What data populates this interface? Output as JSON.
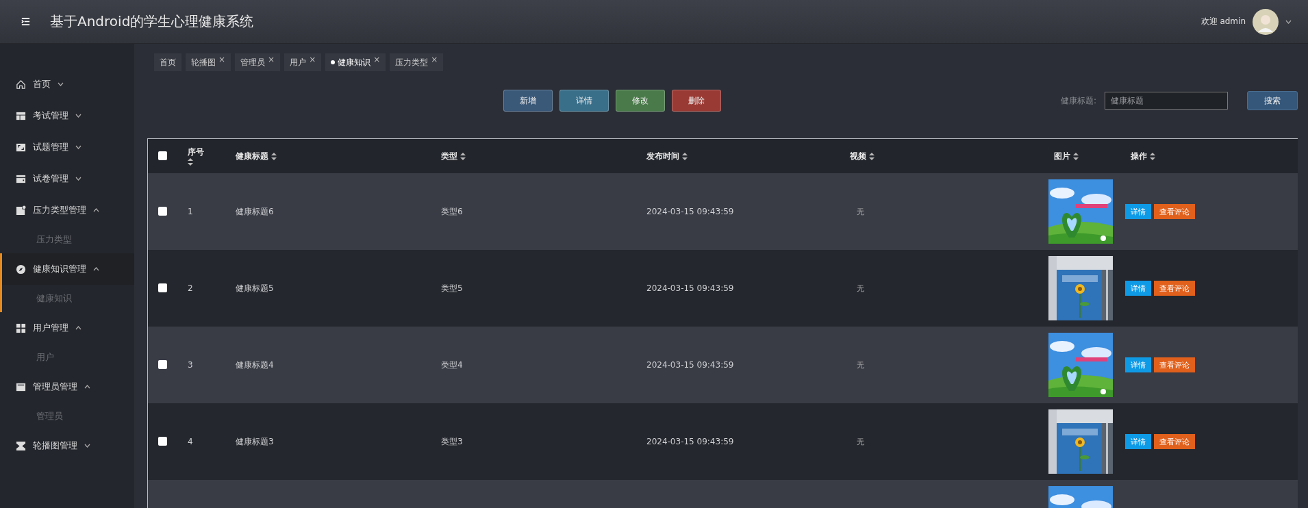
{
  "header": {
    "title": "基于Android的学生心理健康系统",
    "welcome": "欢迎 admin"
  },
  "sidebar": {
    "items": [
      {
        "label": "首页",
        "expanded": false,
        "selected": false
      },
      {
        "label": "考试管理",
        "expanded": false,
        "selected": false
      },
      {
        "label": "试题管理",
        "expanded": false,
        "selected": false
      },
      {
        "label": "试卷管理",
        "expanded": false,
        "selected": false
      },
      {
        "label": "压力类型管理",
        "expanded": true,
        "selected": false,
        "children": [
          {
            "label": "压力类型"
          }
        ]
      },
      {
        "label": "健康知识管理",
        "expanded": true,
        "selected": true,
        "children": [
          {
            "label": "健康知识"
          }
        ]
      },
      {
        "label": "用户管理",
        "expanded": true,
        "selected": false,
        "children": [
          {
            "label": "用户"
          }
        ]
      },
      {
        "label": "管理员管理",
        "expanded": true,
        "selected": false,
        "children": [
          {
            "label": "管理员"
          }
        ]
      },
      {
        "label": "轮播图管理",
        "expanded": false,
        "selected": false
      }
    ]
  },
  "tabs": [
    {
      "label": "首页",
      "selected": false
    },
    {
      "label": "轮播图",
      "close": "×",
      "selected": false
    },
    {
      "label": "管理员",
      "close": "×",
      "selected": false
    },
    {
      "label": "用户",
      "close": "×",
      "selected": false
    },
    {
      "label": "健康知识",
      "close": "×",
      "selected": true
    },
    {
      "label": "压力类型",
      "close": "×",
      "selected": false
    }
  ],
  "actions": [
    {
      "label": "新增",
      "kind": "add"
    },
    {
      "label": "详情",
      "kind": "detail"
    },
    {
      "label": "修改",
      "kind": "edit"
    },
    {
      "label": "删除",
      "kind": "delete"
    }
  ],
  "search": {
    "label": "健康标题:",
    "placeholder": "健康标题",
    "button": "搜索"
  },
  "table": {
    "all_checked": false,
    "columns": [
      "序号",
      "健康标题",
      "类型",
      "发布时间",
      "视频",
      "图片",
      "操作"
    ],
    "rows": [
      {
        "checked": false,
        "no": "1",
        "title": "健康标题6",
        "type": "类型6",
        "time": "2024-03-15 09:43:59",
        "video": "无",
        "image": {
          "kind": "picture"
        },
        "buttons": [
          "详情",
          "查看评论"
        ]
      },
      {
        "checked": false,
        "no": "2",
        "title": "健康标题5",
        "type": "类型5",
        "time": "2024-03-15 09:43:59",
        "video": "无",
        "image": {
          "kind": "picture"
        },
        "buttons": [
          "详情",
          "查看评论"
        ]
      },
      {
        "checked": false,
        "no": "3",
        "title": "健康标题4",
        "type": "类型4",
        "time": "2024-03-15 09:43:59",
        "video": "无",
        "image": {
          "kind": "picture"
        },
        "buttons": [
          "详情",
          "查看评论"
        ]
      },
      {
        "checked": false,
        "no": "4",
        "title": "健康标题3",
        "type": "类型3",
        "time": "2024-03-15 09:43:59",
        "video": "无",
        "image": {
          "kind": "picture"
        },
        "buttons": [
          "详情",
          "查看评论"
        ]
      },
      {
        "image": {
          "kind": "picture"
        }
      }
    ]
  }
}
